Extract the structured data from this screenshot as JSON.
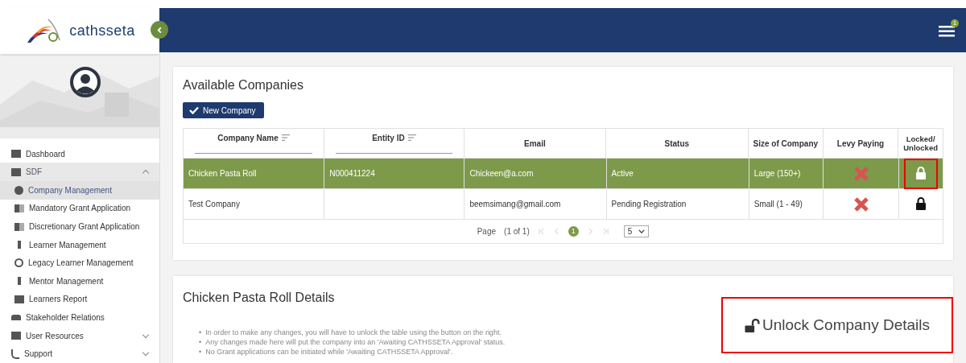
{
  "logo": {
    "text": "cathsseta"
  },
  "header": {
    "notification_count": "1"
  },
  "sidebar": {
    "items": [
      {
        "label": "Dashboard",
        "kind": "dashboard",
        "selected": false
      },
      {
        "label": "SDF",
        "kind": "factory",
        "selected": false,
        "expanded": true,
        "children": [
          {
            "label": "Company Management",
            "kind": "gear",
            "selected": true
          },
          {
            "label": "Mandatory Grant Application",
            "kind": "building",
            "selected": false
          },
          {
            "label": "Discretionary Grant Application",
            "kind": "building",
            "selected": false
          },
          {
            "label": "Learner Management",
            "kind": "person",
            "selected": false
          },
          {
            "label": "Legacy Learner Management",
            "kind": "history",
            "selected": false
          },
          {
            "label": "Mentor Management",
            "kind": "person",
            "selected": false
          },
          {
            "label": "Learners Report",
            "kind": "book",
            "selected": false
          }
        ]
      },
      {
        "label": "Stakeholder Relations",
        "kind": "people",
        "selected": false
      },
      {
        "label": "User Resources",
        "kind": "bookmark",
        "selected": false,
        "expanded": false
      },
      {
        "label": "Support",
        "kind": "phone",
        "selected": false,
        "expanded": false
      }
    ]
  },
  "companies": {
    "title": "Available Companies",
    "new_button": "New Company",
    "columns": [
      {
        "label": "Company Name",
        "sortable": true
      },
      {
        "label": "Entity ID",
        "sortable": true
      },
      {
        "label": "Email",
        "sortable": false
      },
      {
        "label": "Status",
        "sortable": false
      },
      {
        "label": "Size of Company",
        "sortable": false
      },
      {
        "label": "Levy Paying",
        "sortable": false
      },
      {
        "label": "Locked/ Unlocked",
        "sortable": false
      }
    ],
    "rows": [
      {
        "name": "Chicken Pasta Roll",
        "entity_id": "N000411224",
        "email": "Chickeen@a.com",
        "status": "Active",
        "size": "Large (150+)",
        "levy_paying": false,
        "locked": true,
        "selected": true,
        "highlighted": true
      },
      {
        "name": "Test Company",
        "entity_id": "",
        "email": "beemsimang@gmail.com",
        "status": "Pending Registration",
        "size": "Small (1 - 49)",
        "levy_paying": false,
        "locked": true,
        "selected": false,
        "highlighted": false
      }
    ],
    "pager": {
      "label": "Page",
      "summary": "(1 of 1)",
      "current": "1",
      "per_page": "5"
    }
  },
  "details": {
    "title": "Chicken Pasta Roll Details",
    "bullet": "•",
    "notes": [
      "In order to make any changes, you will have to unlock the table using the button on the right.",
      "Any changes made here will put the company into an 'Awaiting CATHSSETA Approval' status.",
      "No Grant applications can be initiated while 'Awaiting CATHSSETA Approval'."
    ],
    "unlock_button": {
      "label": "Unlock Company Details",
      "highlighted": true
    }
  }
}
